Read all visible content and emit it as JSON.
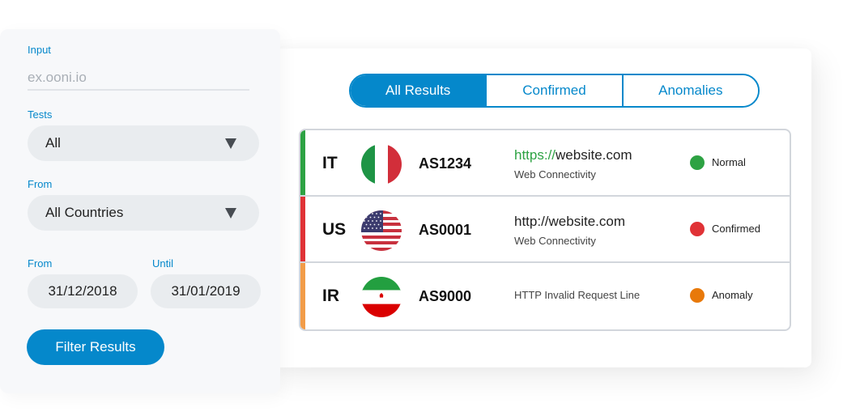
{
  "filters": {
    "input": {
      "label": "Input",
      "placeholder": "ex.ooni.io",
      "value": ""
    },
    "tests": {
      "label": "Tests",
      "selected": "All"
    },
    "country": {
      "label": "From",
      "selected": "All Countries"
    },
    "date_from": {
      "label": "From",
      "value": "31/12/2018"
    },
    "date_until": {
      "label": "Until",
      "value": "31/01/2019"
    },
    "submit_label": "Filter Results"
  },
  "tabs": [
    {
      "label": "All Results",
      "active": true
    },
    {
      "label": "Confirmed",
      "active": false
    },
    {
      "label": "Anomalies",
      "active": false
    }
  ],
  "colors": {
    "accent": "#0588cb",
    "normal": "#2da243",
    "confirmed": "#e03236",
    "anomaly": "#f29c48",
    "anomaly_dot": "#e8790a"
  },
  "results": [
    {
      "country_code": "IT",
      "flag": "italy-flag",
      "asn": "AS1234",
      "url_protocol": "https://",
      "url_host": "website.com",
      "test_name": "Web Connectivity",
      "status": "Normal"
    },
    {
      "country_code": "US",
      "flag": "usa-flag",
      "asn": "AS0001",
      "url_protocol": "http://",
      "url_host": "website.com",
      "test_name": "Web Connectivity",
      "status": "Confirmed"
    },
    {
      "country_code": "IR",
      "flag": "iran-flag",
      "asn": "AS9000",
      "url_protocol": "",
      "url_host": "",
      "test_name": "HTTP Invalid Request Line",
      "status": "Anomaly"
    }
  ]
}
